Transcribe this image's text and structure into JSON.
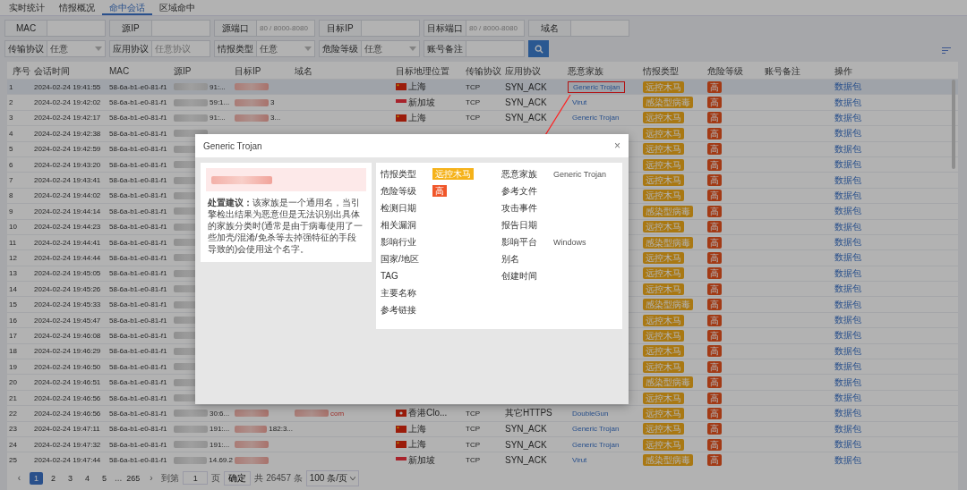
{
  "tabs": [
    {
      "label": "实时统计",
      "selected": false
    },
    {
      "label": "情报概况",
      "selected": false
    },
    {
      "label": "命中会话",
      "selected": true
    },
    {
      "label": "区域命中",
      "selected": false
    }
  ],
  "filters": [
    [
      {
        "label": "MAC",
        "kind": "text"
      },
      {
        "label": "源IP",
        "kind": "text"
      },
      {
        "label": "源端口",
        "kind": "text",
        "placeholder": "80 / 8000-8080"
      },
      {
        "label": "目标IP",
        "kind": "text"
      },
      {
        "label": "目标端口",
        "kind": "text",
        "placeholder": "80 / 8000-8080"
      },
      {
        "label": "域名",
        "kind": "text"
      }
    ],
    [
      {
        "label": "传输协议",
        "kind": "select",
        "value": "任意"
      },
      {
        "label": "应用协议",
        "kind": "text",
        "placeholder": "任意协议"
      },
      {
        "label": "情报类型",
        "kind": "select",
        "value": "任意"
      },
      {
        "label": "危险等级",
        "kind": "select",
        "value": "任意"
      },
      {
        "label": "账号备注",
        "kind": "text"
      }
    ]
  ],
  "table": {
    "columns": [
      "序号",
      "会话时间",
      "MAC",
      "源IP",
      "目标IP",
      "域名",
      "目标地理位置",
      "传输协议",
      "应用协议",
      "恶意家族",
      "情报类型",
      "危险等级",
      "账号备注",
      "操作"
    ],
    "rows": [
      {
        "index": "1",
        "time": "2024-02-24 19:41:55",
        "mac": "58-6a-b1-e0-81-f1",
        "src_tail": "91:...",
        "geo": {
          "text": "上海",
          "kind": "cn"
        },
        "transport": "TCP",
        "app": "SYN_ACK",
        "family": "Generic Trojan",
        "highlighted": true,
        "intel": "远控木马",
        "risk": "高",
        "action": "数据包",
        "selected": true
      },
      {
        "index": "2",
        "time": "2024-02-24 19:42:02",
        "mac": "58-6a-b1-e0-81-f1",
        "src_tail": "59:1...",
        "dst_tail": "3",
        "geo": {
          "text": "新加坡",
          "kind": "sg"
        },
        "transport": "TCP",
        "app": "SYN_ACK",
        "family": "Virut",
        "highlighted": false,
        "intel": "感染型病毒",
        "risk": "高",
        "action": "数据包",
        "selected": false
      },
      {
        "index": "3",
        "time": "2024-02-24 19:42:17",
        "mac": "58-6a-b1-e0-81-f1",
        "src_tail": "91:...",
        "dst_tail": "3...",
        "geo": {
          "text": "上海",
          "kind": "cn"
        },
        "transport": "TCP",
        "app": "SYN_ACK",
        "family": "Generic Trojan",
        "highlighted": false,
        "intel": "远控木马",
        "risk": "高",
        "action": "数据包",
        "selected": false
      },
      {
        "index": "4",
        "time": "2024-02-24 19:42:38",
        "mac": "58-6a-b1-e0-81-f1",
        "intel": "远控木马",
        "risk": "高",
        "action": "数据包",
        "selected": false
      },
      {
        "index": "5",
        "time": "2024-02-24 19:42:59",
        "mac": "58-6a-b1-e0-81-f1",
        "intel": "远控木马",
        "risk": "高",
        "action": "数据包",
        "selected": false
      },
      {
        "index": "6",
        "time": "2024-02-24 19:43:20",
        "mac": "58-6a-b1-e0-81-f1",
        "intel": "远控木马",
        "risk": "高",
        "action": "数据包",
        "selected": false
      },
      {
        "index": "7",
        "time": "2024-02-24 19:43:41",
        "mac": "58-6a-b1-e0-81-f1",
        "intel": "远控木马",
        "risk": "高",
        "action": "数据包",
        "selected": false
      },
      {
        "index": "8",
        "time": "2024-02-24 19:44:02",
        "mac": "58-6a-b1-e0-81-f1",
        "intel": "远控木马",
        "risk": "高",
        "action": "数据包",
        "selected": false
      },
      {
        "index": "9",
        "time": "2024-02-24 19:44:14",
        "mac": "58-6a-b1-e0-81-f1",
        "intel": "感染型病毒",
        "risk": "高",
        "action": "数据包",
        "selected": false
      },
      {
        "index": "10",
        "time": "2024-02-24 19:44:23",
        "mac": "58-6a-b1-e0-81-f1",
        "intel": "远控木马",
        "risk": "高",
        "action": "数据包",
        "selected": false
      },
      {
        "index": "11",
        "time": "2024-02-24 19:44:41",
        "mac": "58-6a-b1-e0-81-f1",
        "intel": "感染型病毒",
        "risk": "高",
        "action": "数据包",
        "selected": false
      },
      {
        "index": "12",
        "time": "2024-02-24 19:44:44",
        "mac": "58-6a-b1-e0-81-f1",
        "intel": "远控木马",
        "risk": "高",
        "action": "数据包",
        "selected": false
      },
      {
        "index": "13",
        "time": "2024-02-24 19:45:05",
        "mac": "58-6a-b1-e0-81-f1",
        "intel": "远控木马",
        "risk": "高",
        "action": "数据包",
        "selected": false
      },
      {
        "index": "14",
        "time": "2024-02-24 19:45:26",
        "mac": "58-6a-b1-e0-81-f1",
        "intel": "远控木马",
        "risk": "高",
        "action": "数据包",
        "selected": false
      },
      {
        "index": "15",
        "time": "2024-02-24 19:45:33",
        "mac": "58-6a-b1-e0-81-f1",
        "intel": "感染型病毒",
        "risk": "高",
        "action": "数据包",
        "selected": false
      },
      {
        "index": "16",
        "time": "2024-02-24 19:45:47",
        "mac": "58-6a-b1-e0-81-f1",
        "intel": "远控木马",
        "risk": "高",
        "action": "数据包",
        "selected": false
      },
      {
        "index": "17",
        "time": "2024-02-24 19:46:08",
        "mac": "58-6a-b1-e0-81-f1",
        "intel": "远控木马",
        "risk": "高",
        "action": "数据包",
        "selected": false
      },
      {
        "index": "18",
        "time": "2024-02-24 19:46:29",
        "mac": "58-6a-b1-e0-81-f1",
        "intel": "远控木马",
        "risk": "高",
        "action": "数据包",
        "selected": false
      },
      {
        "index": "19",
        "time": "2024-02-24 19:46:50",
        "mac": "58-6a-b1-e0-81-f1",
        "intel": "远控木马",
        "risk": "高",
        "action": "数据包",
        "selected": false
      },
      {
        "index": "20",
        "time": "2024-02-24 19:46:51",
        "mac": "58-6a-b1-e0-81-f1",
        "intel": "感染型病毒",
        "risk": "高",
        "action": "数据包",
        "selected": false
      },
      {
        "index": "21",
        "time": "2024-02-24 19:46:56",
        "mac": "58-6a-b1-e0-81-f1",
        "intel": "远控木马",
        "risk": "高",
        "action": "数据包",
        "selected": false
      },
      {
        "index": "22",
        "time": "2024-02-24 19:46:56",
        "mac": "58-6a-b1-e0-81-f1",
        "src_tail": "30:6...",
        "domain_tail": "com",
        "geo": {
          "text": "香港Clo...",
          "kind": "hk"
        },
        "transport": "TCP",
        "app": "其它HTTPS",
        "family": "DoubleGun",
        "highlighted": false,
        "intel": "远控木马",
        "risk": "高",
        "action": "数据包",
        "selected": false
      },
      {
        "index": "23",
        "time": "2024-02-24 19:47:11",
        "mac": "58-6a-b1-e0-81-f1",
        "src_tail": "191:...",
        "dst_tail": "182:3...",
        "geo": {
          "text": "上海",
          "kind": "cn"
        },
        "transport": "TCP",
        "app": "SYN_ACK",
        "family": "Generic Trojan",
        "highlighted": false,
        "intel": "远控木马",
        "risk": "高",
        "action": "数据包",
        "selected": false
      },
      {
        "index": "24",
        "time": "2024-02-24 19:47:32",
        "mac": "58-6a-b1-e0-81-f1",
        "src_tail": "191:...",
        "geo": {
          "text": "上海",
          "kind": "cn"
        },
        "transport": "TCP",
        "app": "SYN_ACK",
        "family": "Generic Trojan",
        "highlighted": false,
        "intel": "远控木马",
        "risk": "高",
        "action": "数据包",
        "selected": false
      },
      {
        "index": "25",
        "time": "2024-02-24 19:47:44",
        "mac": "58-6a-b1-e0-81-f1",
        "src_tail": "14.69.2",
        "geo": {
          "text": "新加坡",
          "kind": "sg"
        },
        "transport": "TCP",
        "app": "SYN_ACK",
        "family": "Virut",
        "highlighted": false,
        "intel": "感染型病毒",
        "risk": "高",
        "action": "数据包",
        "selected": false
      }
    ]
  },
  "pagination": {
    "prev": "‹",
    "pages": [
      {
        "label": "1",
        "selected": true
      },
      {
        "label": "2",
        "selected": false
      },
      {
        "label": "3",
        "selected": false
      },
      {
        "label": "4",
        "selected": false
      },
      {
        "label": "5",
        "selected": false
      }
    ],
    "ellipsis": "...",
    "last": "265",
    "next": "›",
    "goto_label": "到第",
    "goto_value": "1",
    "page_unit": "页",
    "confirm": "确定",
    "total": "共 26457 条",
    "page_size": "100 条/页"
  },
  "modal": {
    "title": "Generic Trojan",
    "close": "×",
    "advice": "**处置建议：**该家族是一个通用名，当引擎检出结果为恶意但是无法识别出具体的家族分类时(通常是由于病毒使用了一些加壳/混淆/免杀等去掉强特征的手段导致的)会使用这个名字。",
    "fields_left": [
      {
        "label": "情报类型",
        "kind": "tag",
        "value": "远控木马",
        "color": "#f5b21a"
      },
      {
        "label": "危险等级",
        "kind": "tag",
        "value": "高",
        "color": "#f0562a"
      },
      {
        "label": "检测日期"
      },
      {
        "label": "相关漏洞"
      },
      {
        "label": "影响行业"
      },
      {
        "label": "国家/地区"
      },
      {
        "label": "TAG"
      },
      {
        "label": "主要名称"
      },
      {
        "label": "参考链接"
      }
    ],
    "fields_right": [
      {
        "label": "恶意家族",
        "kind": "text",
        "value": "Generic Trojan"
      },
      {
        "label": "参考文件"
      },
      {
        "label": "攻击事件"
      },
      {
        "label": "报告日期"
      },
      {
        "label": "影响平台",
        "kind": "text",
        "value": "Windows"
      },
      {
        "label": "别名"
      },
      {
        "label": "创建时间"
      }
    ]
  }
}
